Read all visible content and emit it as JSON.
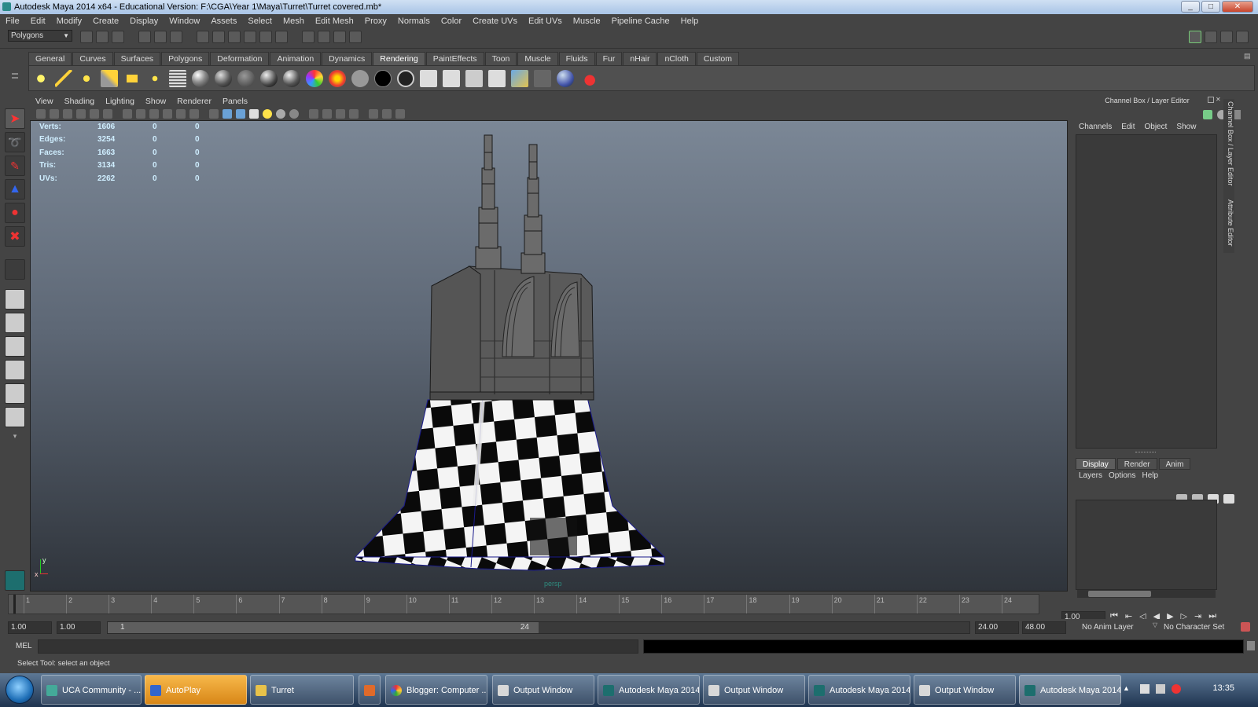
{
  "window": {
    "title": "Autodesk Maya 2014 x64 - Educational Version: F:\\CGA\\Year 1\\Maya\\Turret\\Turret covered.mb*",
    "minimize": "_",
    "maximize": "□",
    "close": "✕"
  },
  "menubar": [
    "File",
    "Edit",
    "Modify",
    "Create",
    "Display",
    "Window",
    "Assets",
    "Select",
    "Mesh",
    "Edit Mesh",
    "Proxy",
    "Normals",
    "Color",
    "Create UVs",
    "Edit UVs",
    "Muscle",
    "Pipeline Cache",
    "Help"
  ],
  "statusline": {
    "mode": "Polygons"
  },
  "shelf": {
    "tabs": [
      "General",
      "Curves",
      "Surfaces",
      "Polygons",
      "Deformation",
      "Animation",
      "Dynamics",
      "Rendering",
      "PaintEffects",
      "Toon",
      "Muscle",
      "Fluids",
      "Fur",
      "nHair",
      "nCloth",
      "Custom"
    ],
    "active_tab": "Rendering"
  },
  "viewport": {
    "menu": [
      "View",
      "Shading",
      "Lighting",
      "Show",
      "Renderer",
      "Panels"
    ],
    "hud": [
      {
        "label": "Verts:",
        "v1": "1606",
        "v2": "0",
        "v3": "0"
      },
      {
        "label": "Edges:",
        "v1": "3254",
        "v2": "0",
        "v3": "0"
      },
      {
        "label": "Faces:",
        "v1": "1663",
        "v2": "0",
        "v3": "0"
      },
      {
        "label": "Tris:",
        "v1": "3134",
        "v2": "0",
        "v3": "0"
      },
      {
        "label": "UVs:",
        "v1": "2262",
        "v2": "0",
        "v3": "0"
      }
    ],
    "camera": "persp",
    "axis_y": "y",
    "axis_x": "x"
  },
  "channel_box": {
    "header": "Channel Box / Layer Editor",
    "menu": [
      "Channels",
      "Edit",
      "Object",
      "Show"
    ]
  },
  "layer_editor": {
    "tabs": [
      "Display",
      "Render",
      "Anim"
    ],
    "active_tab": "Display",
    "menu": [
      "Layers",
      "Options",
      "Help"
    ]
  },
  "side_tabs": [
    "Channel Box / Layer Editor",
    "Attribute Editor"
  ],
  "time_slider": {
    "ticks": [
      "1",
      "2",
      "3",
      "4",
      "5",
      "6",
      "7",
      "8",
      "9",
      "10",
      "11",
      "12",
      "13",
      "14",
      "15",
      "16",
      "17",
      "18",
      "19",
      "20",
      "21",
      "22",
      "23",
      "24"
    ],
    "current_frame": "1.00"
  },
  "range_slider": {
    "start_time": "1.00",
    "playback_start": "1.00",
    "range_start_label": "1",
    "range_end_label": "24",
    "playback_end": "24.00",
    "end_time": "48.00",
    "anim_layer": "No Anim Layer",
    "character_set": "No Character Set"
  },
  "command_line": {
    "label": "MEL"
  },
  "help_line": "Select Tool: select an object",
  "taskbar": {
    "items": [
      {
        "label": "UCA Community - ...",
        "highlight": false
      },
      {
        "label": "AutoPlay",
        "highlight": true
      },
      {
        "label": "Turret",
        "highlight": false
      },
      {
        "label": "",
        "highlight": false
      },
      {
        "label": "Blogger: Computer ...",
        "highlight": false
      },
      {
        "label": "Output Window",
        "highlight": false
      },
      {
        "label": "Autodesk Maya 2014...",
        "highlight": false
      },
      {
        "label": "Output Window",
        "highlight": false
      },
      {
        "label": "Autodesk Maya 2014...",
        "highlight": false
      },
      {
        "label": "Output Window",
        "highlight": false
      },
      {
        "label": "Autodesk Maya 2014...",
        "highlight": false
      }
    ],
    "clock": "13:35"
  },
  "colors": {
    "ui_bg": "#444444",
    "taskbar_highlight": "#e69a2a",
    "hud_text": "#cfeeff",
    "title_bar": "#bcd2ee"
  }
}
